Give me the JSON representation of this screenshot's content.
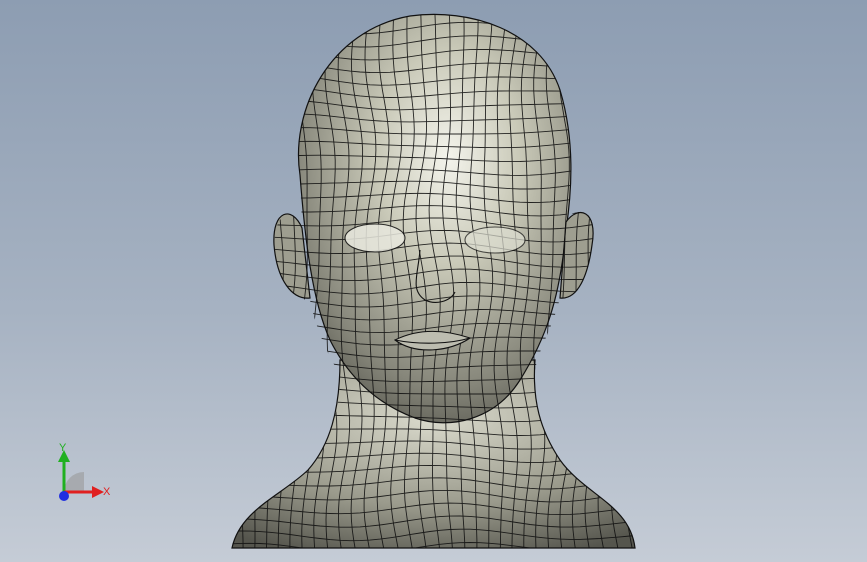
{
  "viewport": {
    "background_top": "#8d9db2",
    "background_bottom": "#c5ccd6",
    "model_fill": "#a7a796",
    "wire_color": "#111111"
  },
  "triad": {
    "y_label": "Y",
    "x_label": "X",
    "y_color": "#20b020",
    "x_color": "#e02020",
    "z_color": "#1f2fe0"
  }
}
